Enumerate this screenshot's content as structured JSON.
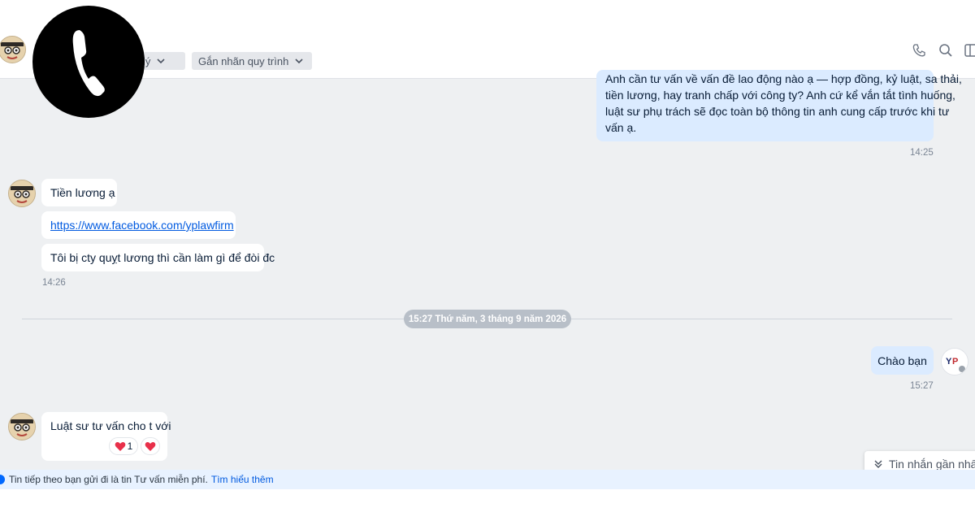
{
  "header": {
    "chip_classify": "lý",
    "chip_tag": "Gắn nhãn quy trình"
  },
  "icons": {
    "call": "phone-icon",
    "search": "search-icon",
    "panel": "sidebar-panel-icon",
    "chevron": "chevron-down-icon"
  },
  "messages": {
    "out1": {
      "lines": [
        "Anh cần tư vấn về vấn đề lao động nào ạ — hợp đồng, kỷ luật, sa thải,",
        "tiền lương, hay tranh chấp với công ty? Anh cứ kể vắn tắt tình huống,",
        "luật sư phụ trách sẽ đọc toàn bộ thông tin anh cung cấp trước khi tư",
        "vấn ạ."
      ],
      "time": "14:25"
    },
    "in1": {
      "text1": "Tiền lương ạ",
      "link": "https://www.facebook.com/yplawfirm",
      "text2": "Tôi bị cty quỵt lương thì cần làm gì để đòi đc",
      "time": "14:26"
    },
    "date_separator": "15:27 Thứ năm, 3 tháng 9 năm 2026",
    "out2": {
      "text": "Chào bạn",
      "time": "15:27"
    },
    "in2": {
      "text": "Luật sư tư vấn cho t với",
      "reaction_count": "1"
    }
  },
  "notice": {
    "text": "Tin tiếp theo bạn gửi đi là tin Tư vấn miễn phí.",
    "link": "Tìm hiểu thêm"
  },
  "jump_latest": "Tin nhắn gần nhất",
  "colors": {
    "bubble_out": "#dbebff",
    "bubble_in": "#ffffff",
    "background": "#eef0f2",
    "link": "#005ae0",
    "heart": "#e8304a"
  }
}
